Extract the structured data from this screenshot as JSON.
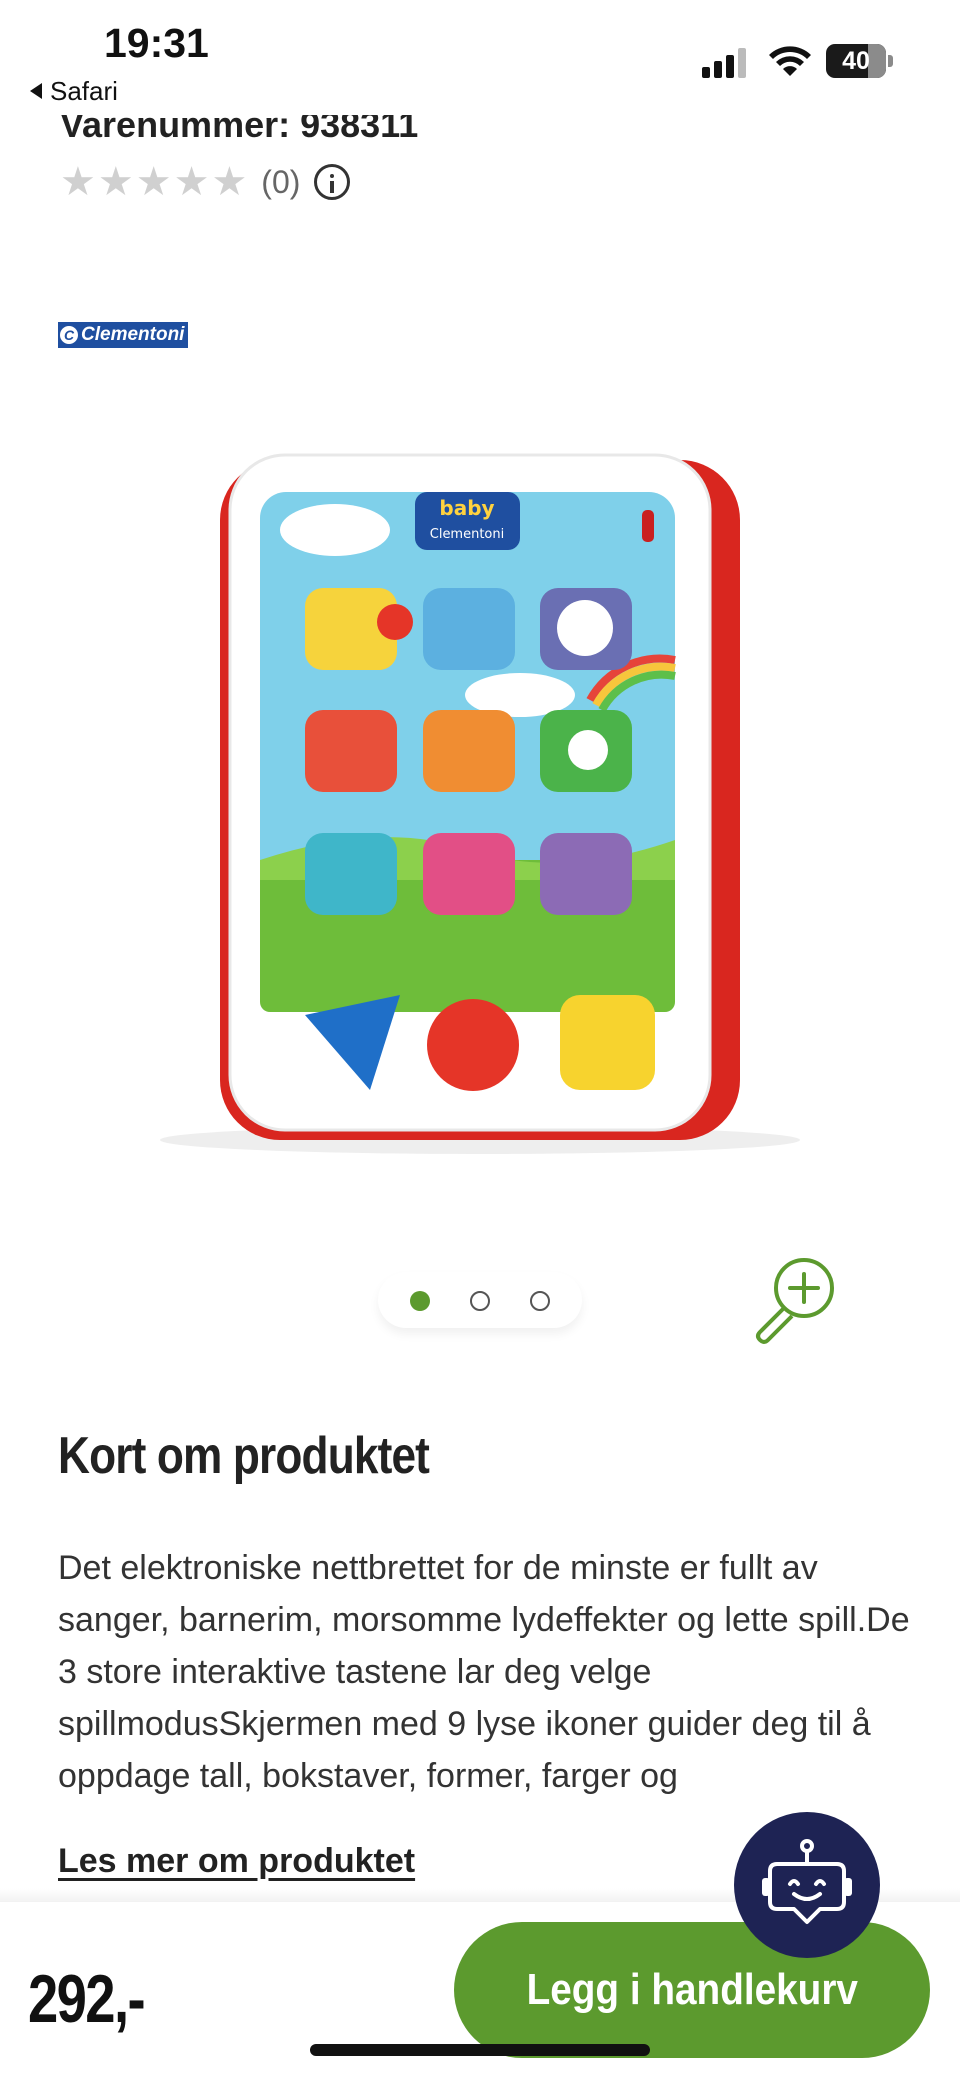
{
  "status_bar": {
    "time": "19:31",
    "back_app": "Safari",
    "battery_level": "40"
  },
  "product": {
    "sku_text": "Varenummer: 938311",
    "rating_stars_filled": 0,
    "rating_stars_total": 5,
    "rating_count": "(0)",
    "brand": "Clementoni",
    "image_alt_icon": "product-photo"
  },
  "gallery": {
    "total_images": 3,
    "active_index": 0
  },
  "about": {
    "title": "Kort om produktet",
    "description": "Det elektroniske nettbrettet for de minste er fullt av sanger, barnerim, morsomme lydeffekter og lette spill.De 3 store interaktive tastene lar deg velge spillmodusSkjermen med 9 lyse ikoner guider deg til å oppdage tall, bokstaver, former, farger og",
    "read_more": "Les mer om produktet"
  },
  "purchase": {
    "price": "292,-",
    "add_to_cart": "Legg i handlekurv"
  },
  "colors": {
    "brand_green": "#5c9a2e",
    "chat_navy": "#1e2354",
    "logo_blue": "#1f4fa0",
    "tablet_red": "#e12b2b"
  }
}
